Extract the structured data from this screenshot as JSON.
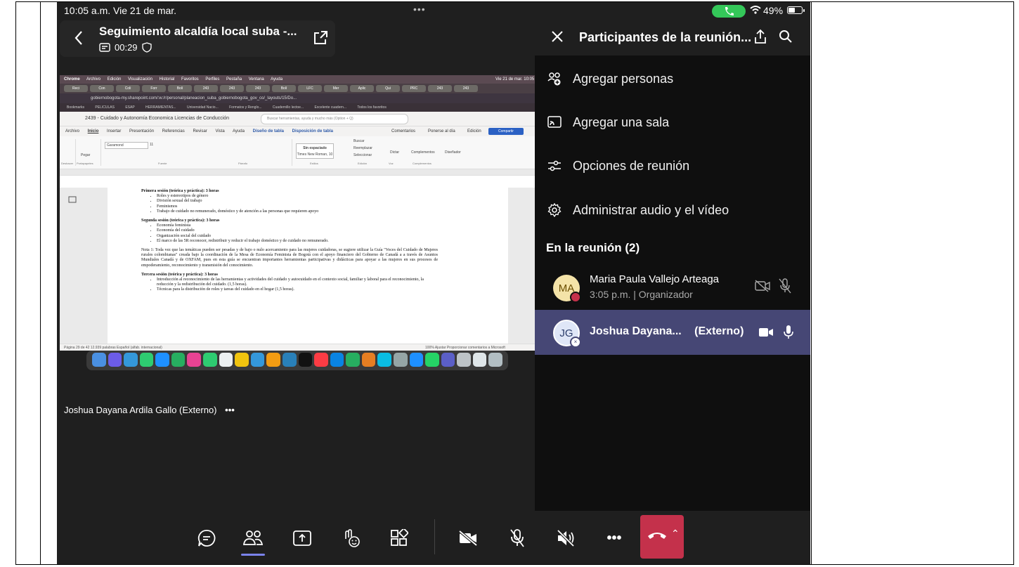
{
  "status": {
    "time": "10:05 a.m.  Vie 21 de mar.",
    "dots": "•••",
    "battery": "49%"
  },
  "meeting": {
    "title": "Seguimiento alcaldía local suba -...",
    "timer": "00:29"
  },
  "shared_screen": {
    "menubar": [
      "Chrome",
      "Archivo",
      "Edición",
      "Visualización",
      "Historial",
      "Favoritos",
      "Perfiles",
      "Pestaña",
      "Ventana",
      "Ayuda"
    ],
    "menubar_right": "Vie 21 de mar.  10:05",
    "tabs": [
      "Reci",
      "Con",
      "Coli",
      "Forr",
      "Bolí",
      "243",
      "243",
      "243",
      "Bolí",
      "LFC",
      "Mer",
      "Aplic",
      "Qui",
      "PRC",
      "243",
      "243"
    ],
    "url": "gobiernobogota-my.sharepoint.com/:w:/r/personal/planeacion_suba_gobiernobogota_gov_co/_layouts/15/Do...",
    "bookmarks": [
      "Bookmarks",
      "PELICULAS",
      "ESAP",
      "HERRAMIENTAS...",
      "Universidad Nacio...",
      "Formatos y Renglo...",
      "Cuadernillo lectoe...",
      "Excelente cuadern...",
      "Todos los favoritos"
    ],
    "doc_title": "2439 - Cuidado y Autonomía Economica Licencias de Conducción",
    "search_placeholder": "Buscar herramientas, ayuda y mucho más (Option + Q)",
    "ribbon_tabs": [
      "Archivo",
      "Inicio",
      "Insertar",
      "Presentación",
      "Referencias",
      "Revisar",
      "Vista",
      "Ayuda",
      "Diseño de tabla",
      "Disposición de tabla"
    ],
    "ribbon_right": [
      "Comentarios",
      "Ponerse al día",
      "Edición"
    ],
    "share_label": "Compartir",
    "font_name": "Garamond",
    "font_size": "11",
    "style_name": "Sin espaciado",
    "style_sub": "Times New Roman, 10",
    "ribbon_groups": [
      "Deshacer",
      "Portapapeles",
      "Fuente",
      "Párrafo",
      "Estilos",
      "Edición",
      "Voz",
      "Complementos"
    ],
    "ribbon_buttons": [
      "Pegar",
      "Buscar",
      "Reemplazar",
      "Seleccionar",
      "Dictar",
      "Complementos",
      "Diseñador"
    ],
    "doc": {
      "s1_title": "Primera sesión (teórica y práctica): 3 horas",
      "s1_items": [
        "Roles y estereotipos de género",
        "División sexual del trabajo",
        "Feminismos",
        "Trabajo de cuidado no remunerado, doméstico y de atención a las personas que requieren apoyo"
      ],
      "s2_title": "Segunda sesión (teórica y práctica): 3 horas",
      "s2_items": [
        "Economía feminista",
        "Economía del cuidado",
        "Organización social del cuidado",
        "El marco de las 5R reconocer, redistribuir y reducir el trabajo doméstico y de cuidado no remunerado."
      ],
      "note": "Nota 1: Toda vez que las temáticas pueden ser pesadas y de bajo o nulo acercamiento para las mujeres cuidadoras, se sugiere utilizar la Guía \"Voces del Cuidado de Mujeres rurales colombianas\" creada bajo la coordinación de la Mesa de Economía Feminista de Bogotá con el apoyo financiero del Gobierno de Canadá a a través de Asuntos Mundiales Canadá y de OXFAM, pues en esta guía se encuentran importantes herramientas participativas y didácticas para apoyar a las mujeres en sus procesos de empoderamiento, reconocimiento y transmisión del conocimiento.",
      "s3_title": "Tercera sesión (teórica y práctica): 3 horas",
      "s3_items": [
        "Introducción al reconocimiento de las herramientas y actividades del cuidado y autocuidado en el contexto social, familiar y laboral para el reconocimiento, la reducción y la redistribución del cuidado. (1,5 horas).",
        "Técnicas para la distribución de roles y tareas del cuidado en el hogar (1,5 horas)."
      ],
      "statusbar": "Página 29 de 42   12.939 palabras   Español (alfab. internacional)",
      "statusbar_right": "100%   Ajustar   Proporcionar comentarios a Microsoft"
    }
  },
  "spotlight_name": "Joshua Dayana Ardila Gallo (Externo)",
  "spotlight_more": "•••",
  "panel": {
    "title": "Participantes de la reunión...",
    "actions": [
      "Agregar personas",
      "Agregar una sala",
      "Opciones de reunión",
      "Administrar audio y el vídeo"
    ],
    "section": "En la reunión (2)",
    "participants": [
      {
        "initials": "MA",
        "name": "Maria Paula Vallejo Arteaga",
        "sub": "3:05 p.m. | Organizador",
        "avatar_bg": "#f4e3a8",
        "avatar_fg": "#6b4e00"
      },
      {
        "initials": "JG",
        "name": "Joshua Dayana...",
        "tag": "(Externo)",
        "avatar_bg": "#dfe6f7",
        "avatar_fg": "#2b3d6b"
      }
    ]
  },
  "colors": {
    "accent": "#7b83eb",
    "leave": "#c4314b",
    "selected_row": "#464775",
    "call_pill": "#34c759"
  }
}
